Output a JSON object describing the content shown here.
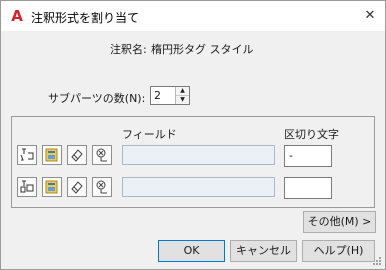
{
  "window": {
    "title": "注釈形式を割り当て",
    "app_icon_letter": "A",
    "close_symbol": "✕"
  },
  "annotation": {
    "label": "注釈名:",
    "value": "楕円形タグ スタイル"
  },
  "subparts": {
    "label": "サブパーツの数(N):",
    "value": "2",
    "up_symbol": "▲",
    "down_symbol": "▼"
  },
  "table": {
    "field_header": "フィールド",
    "separator_header": "区切り文字",
    "rows": [
      {
        "field_value": "",
        "separator_value": "-"
      },
      {
        "field_value": "",
        "separator_value": ""
      }
    ]
  },
  "buttons": {
    "more": "その他(M) >",
    "ok": "OK",
    "cancel": "キャンセル",
    "help": "ヘルプ(H)"
  },
  "colors": {
    "brand_red": "#d6202a",
    "default_button_border": "#0078d7"
  }
}
